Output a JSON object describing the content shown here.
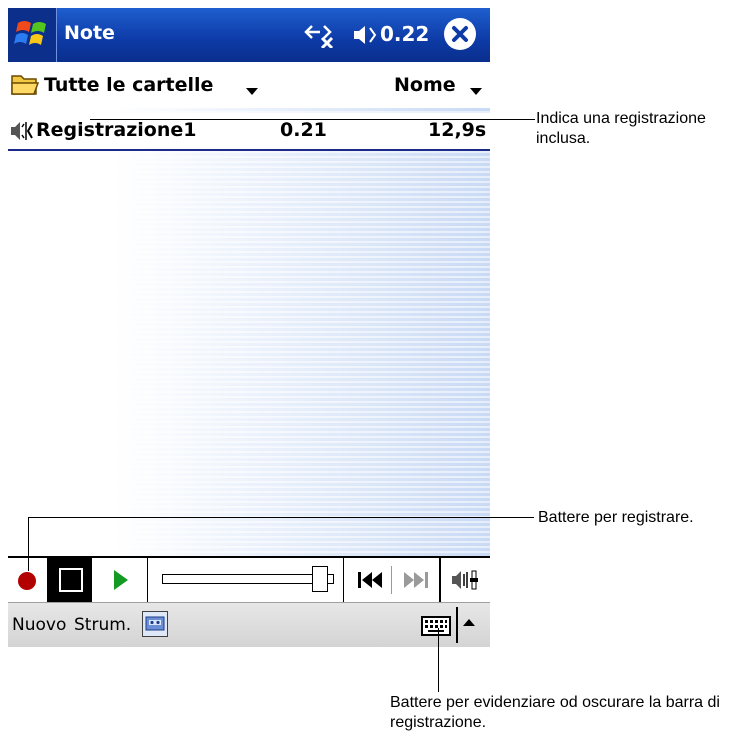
{
  "titlebar": {
    "app_title": "Note",
    "clock": "0.22",
    "icons": [
      "windows-start-icon",
      "connectivity-icon",
      "volume-icon",
      "close-icon"
    ]
  },
  "folderbar": {
    "folder": "Tutte le cartelle",
    "sort": "Nome"
  },
  "recordings": [
    {
      "name": "Registrazione1",
      "time": "0.21",
      "length": "12,9s"
    }
  ],
  "recording_toolbar": {
    "buttons": [
      "record-icon",
      "stop-icon",
      "play-icon",
      "previous-icon",
      "next-icon",
      "volume-icon"
    ],
    "colors": {
      "record": "#b30000",
      "play": "#129a22"
    }
  },
  "menubar": {
    "new": "Nuovo",
    "tools": "Strum."
  },
  "callouts": {
    "recording": "Indica una registrazione inclusa.",
    "record": "Battere per registrare.",
    "toggle_bar": "Battere per evidenziare od oscurare la barra di registrazione."
  },
  "colors": {
    "titlebar": "#0d3aa6",
    "selection_line": "#1c2a8a"
  }
}
